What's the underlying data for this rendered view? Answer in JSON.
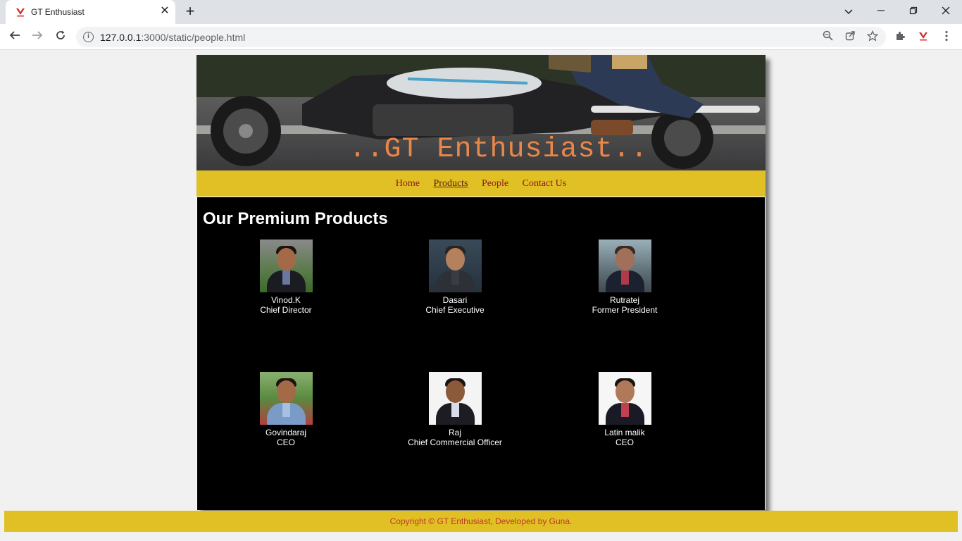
{
  "browser": {
    "tab_title": "GT Enthusiast",
    "url_host": "127.0.0.1",
    "url_rest": ":3000/static/people.html"
  },
  "site": {
    "title": "..GT Enthusiast..",
    "nav": [
      "Home",
      "Products",
      "People",
      "Contact Us"
    ],
    "active_nav": "Products",
    "heading": "Our Premium Products",
    "people": [
      {
        "name": "Vinod.K",
        "role": "Chief Director"
      },
      {
        "name": "Dasari",
        "role": "Chief Executive"
      },
      {
        "name": "Rutratej",
        "role": "Former President"
      },
      {
        "name": "Govindaraj",
        "role": "CEO"
      },
      {
        "name": "Raj",
        "role": "Chief Commercial Officer"
      },
      {
        "name": "Latin malik",
        "role": "CEO"
      }
    ],
    "footer": "Copyright © GT Enthusiast, Developed by Guna."
  },
  "colors": {
    "nav_bar": "#e0c025",
    "title": "#e8874a",
    "nav_link": "#8b1a1a",
    "footer_text": "#c0392b",
    "content_bg": "#000000"
  }
}
